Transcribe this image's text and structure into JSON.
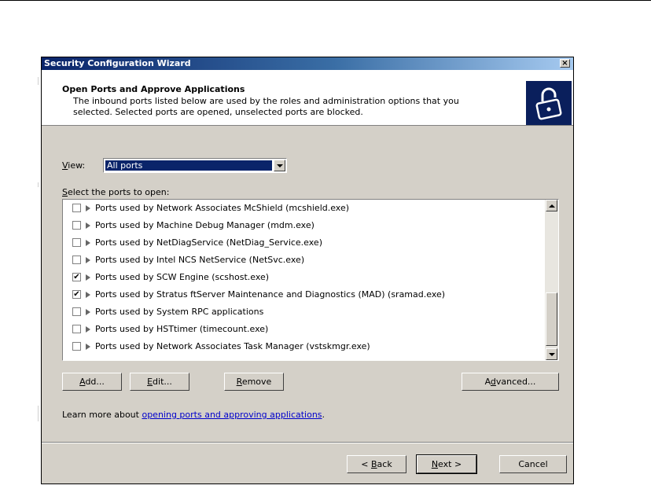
{
  "window": {
    "title": "Security Configuration Wizard",
    "close_glyph": "×"
  },
  "header": {
    "title": "Open Ports and Approve Applications",
    "description": "The inbound ports listed below are used by the roles and administration options that you selected. Selected ports are opened, unselected ports are blocked.",
    "icon": "padlock-icon"
  },
  "view": {
    "label": "View:",
    "value": "All ports"
  },
  "ports": {
    "label": "Select the ports to open:",
    "items": [
      {
        "label": "Ports used by Network Associates McShield (mcshield.exe)",
        "checked": false,
        "mark": ""
      },
      {
        "label": "Ports used by Machine Debug Manager (mdm.exe)",
        "checked": false,
        "mark": ""
      },
      {
        "label": "Ports used by NetDiagService (NetDiag_Service.exe)",
        "checked": false,
        "mark": ""
      },
      {
        "label": "Ports used by Intel NCS NetService (NetSvc.exe)",
        "checked": false,
        "mark": ""
      },
      {
        "label": "Ports used by SCW Engine (scshost.exe)",
        "checked": true,
        "mark": "✔"
      },
      {
        "label": "Ports used by Stratus ftServer Maintenance and Diagnostics (MAD) (sramad.exe)",
        "checked": true,
        "mark": "✔"
      },
      {
        "label": "Ports used by System RPC applications",
        "checked": false,
        "mark": ""
      },
      {
        "label": "Ports used by HSTtimer (timecount.exe)",
        "checked": false,
        "mark": ""
      },
      {
        "label": "Ports used by Network Associates Task Manager (vstskmgr.exe)",
        "checked": false,
        "mark": ""
      }
    ]
  },
  "buttons": {
    "add": "Add...",
    "edit": "Edit...",
    "remove": "Remove",
    "advanced": "Advanced...",
    "back": "< Back",
    "next": "Next >",
    "cancel": "Cancel"
  },
  "learn": {
    "prefix": "Learn more about ",
    "link": "opening ports and approving applications",
    "suffix": "."
  }
}
